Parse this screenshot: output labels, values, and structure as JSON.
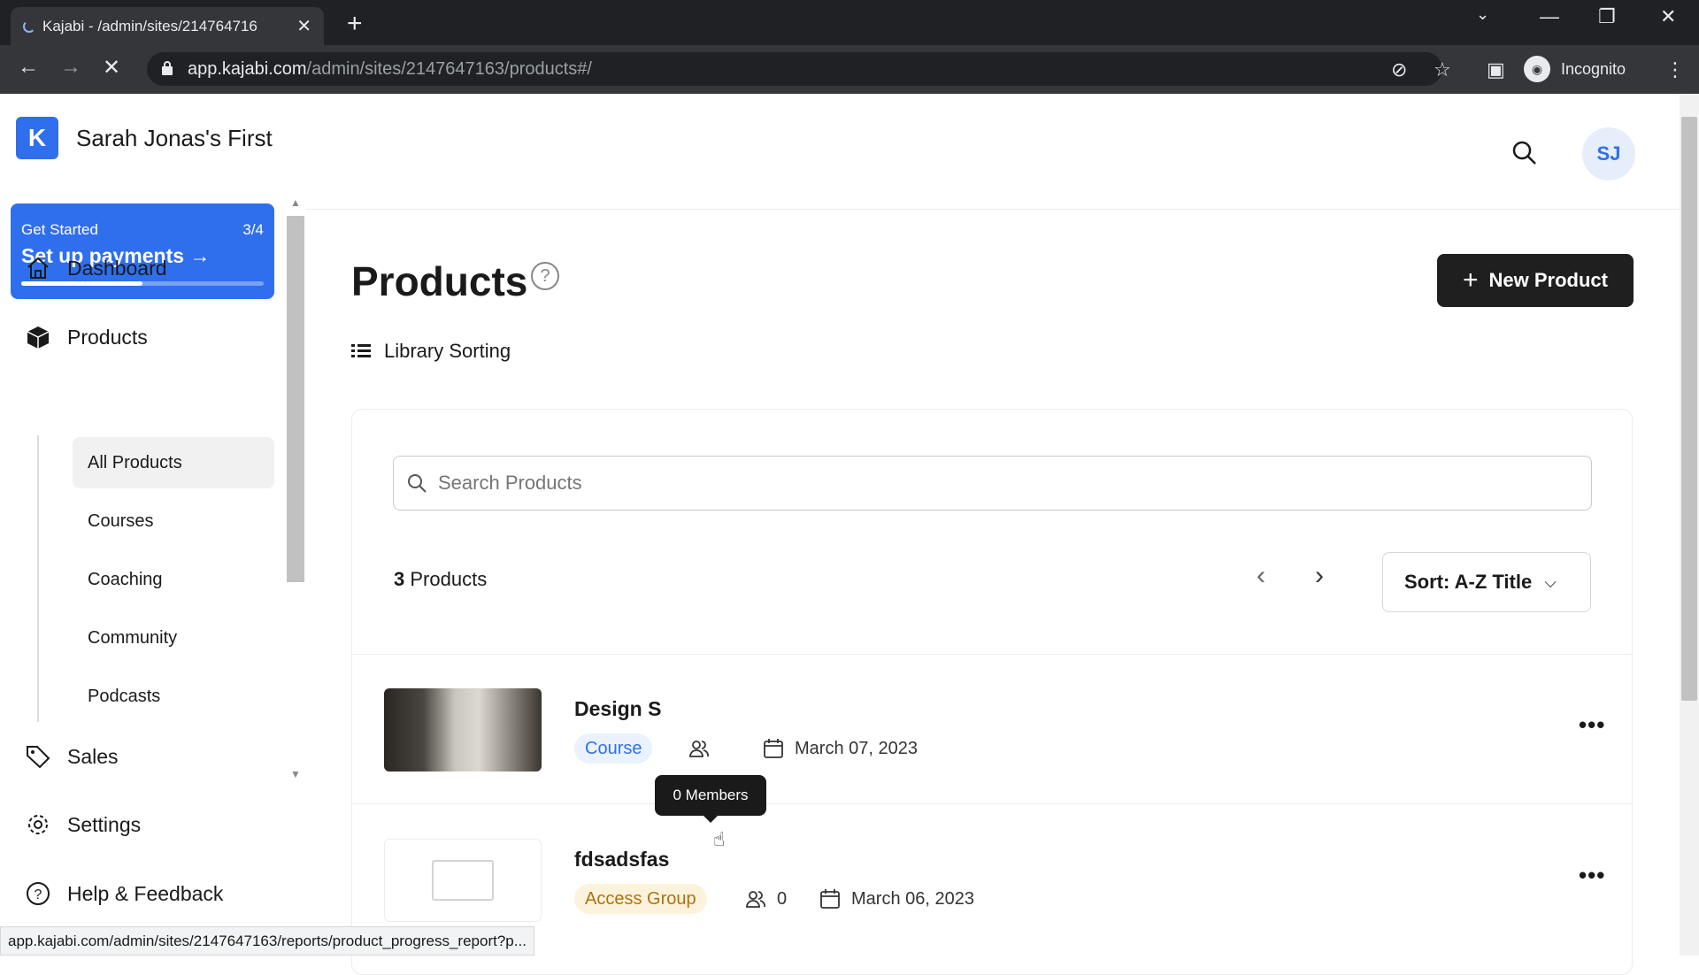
{
  "browser": {
    "tab_title": "Kajabi - /admin/sites/214764716",
    "url_host": "app.kajabi.com",
    "url_path": "/admin/sites/2147647163/products#/",
    "incognito_label": "Incognito",
    "status_url": "app.kajabi.com/admin/sites/2147647163/reports/product_progress_report?p..."
  },
  "sidebar": {
    "brand_name": "Sarah Jonas's First",
    "get_started": {
      "label": "Get Started",
      "count": "3/4",
      "title": "Set up payments",
      "progress": 0.5
    },
    "items": [
      {
        "label": "Dashboard",
        "icon": "home-icon"
      },
      {
        "label": "Products",
        "icon": "box-icon"
      },
      {
        "label": "Sales",
        "icon": "tag-icon"
      },
      {
        "label": "Settings",
        "icon": "gear-icon"
      },
      {
        "label": "Help & Feedback",
        "icon": "help-circle-icon"
      }
    ],
    "sub_items": [
      "All Products",
      "Courses",
      "Coaching",
      "Community",
      "Podcasts"
    ],
    "active_sub": "All Products"
  },
  "header": {
    "avatar_initials": "SJ"
  },
  "main": {
    "title": "Products",
    "new_button": "New Product",
    "library_sorting": "Library Sorting",
    "search_placeholder": "Search Products",
    "count_number": "3",
    "count_label": "Products",
    "sort_label": "Sort: A-Z Title"
  },
  "products": [
    {
      "title": "Design S",
      "type": "Course",
      "members": "",
      "date": "March 07, 2023"
    },
    {
      "title": "fdsadsfas",
      "type": "Access Group",
      "members": "0",
      "date": "March 06, 2023"
    }
  ],
  "tooltip": "0 Members",
  "colors": {
    "accent": "#2f6fed",
    "button_dark": "#1f1f1f",
    "course_tag": "#eaf2fd",
    "access_tag": "#fdf3dc"
  }
}
